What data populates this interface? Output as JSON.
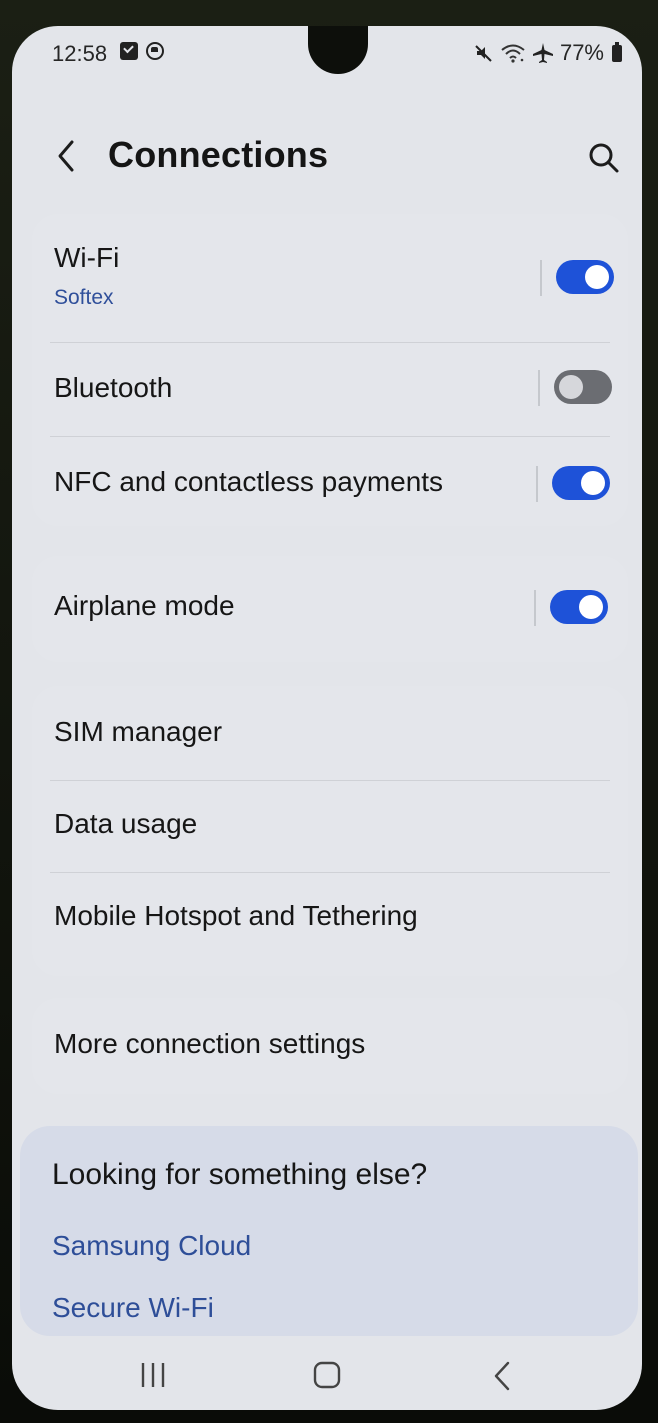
{
  "status_bar": {
    "time": "12:58",
    "battery": "77%",
    "icons": [
      "checkbox-notification-icon",
      "circle-notification-icon",
      "mute-icon",
      "wifi-icon",
      "airplane-icon",
      "battery-icon"
    ]
  },
  "header": {
    "title": "Connections",
    "back_icon": "chevron-left-icon",
    "search_icon": "search-icon"
  },
  "settings": {
    "wifi": {
      "label": "Wi-Fi",
      "sub": "Softex",
      "toggle": true
    },
    "bluetooth": {
      "label": "Bluetooth",
      "toggle": false
    },
    "nfc": {
      "label": "NFC and contactless payments",
      "toggle": true
    },
    "airplane": {
      "label": "Airplane mode",
      "toggle": true
    },
    "sim_manager": {
      "label": "SIM manager"
    },
    "data_usage": {
      "label": "Data usage"
    },
    "hotspot": {
      "label": "Mobile Hotspot and Tethering"
    },
    "more": {
      "label": "More connection settings"
    }
  },
  "suggestions": {
    "title": "Looking for something else?",
    "links": [
      "Samsung Cloud",
      "Secure Wi-Fi"
    ]
  },
  "colors": {
    "accent": "#1e52d8",
    "link": "#2e4e98",
    "background": "#e3e5ea"
  }
}
